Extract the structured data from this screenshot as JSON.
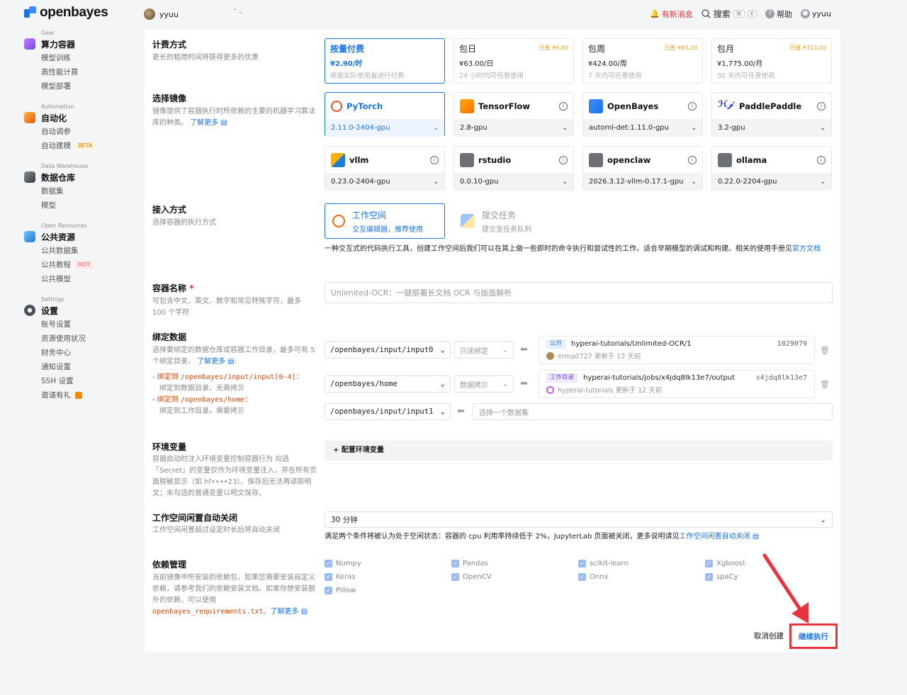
{
  "brand": {
    "name": "openbayes"
  },
  "header": {
    "user_name": "yyuu",
    "notice": "有新消息",
    "search": "搜索",
    "search_kbd_1": "⌘",
    "search_kbd_2": "K",
    "help": "帮助",
    "account_name": "yyuu"
  },
  "sidebar": {
    "groups": [
      {
        "sub": "Gear",
        "title": "算力容器",
        "items": [
          "模型训练",
          "高性能计算",
          "模型部署"
        ]
      },
      {
        "sub": "Automation",
        "title": "自动化",
        "items": [
          "自动调参",
          "自动建模"
        ],
        "tag": "BETA"
      },
      {
        "sub": "Data Warehouse",
        "title": "数据仓库",
        "items": [
          "数据集",
          "模型"
        ]
      },
      {
        "sub": "Open Resources",
        "title": "公共资源",
        "items": [
          "公共数据集",
          "公共教程",
          "公共模型"
        ],
        "tag": "HOT"
      },
      {
        "sub": "Settings",
        "title": "设置",
        "items": [
          "账号设置",
          "资源使用状况",
          "财务中心",
          "通知设置",
          "SSH 设置",
          "邀请有礼"
        ]
      }
    ]
  },
  "billing": {
    "title": "计费方式",
    "desc": "更长的租用时间将获得更多的优惠",
    "options": [
      {
        "name": "按量付费",
        "price": "¥2.90/时",
        "desc": "根据实际使用量进行付费",
        "save": ""
      },
      {
        "name": "包日",
        "price": "¥63.00/日",
        "desc": "24 小时内可任意使用",
        "save": "已省 ¥6.60"
      },
      {
        "name": "包周",
        "price": "¥424.00/周",
        "desc": "7 天内可任意使用",
        "save": "已省 ¥63.20"
      },
      {
        "name": "包月",
        "price": "¥1,775.00/月",
        "desc": "30 天内可任意使用",
        "save": "已省 ¥313.00"
      }
    ]
  },
  "image": {
    "title": "选择镜像",
    "desc": "镜像提供了容器执行时所依赖的主要的机器学习算法库的种类。",
    "learn_more": "了解更多",
    "cards": [
      {
        "name": "PyTorch",
        "version": "2.11.0-2404-gpu"
      },
      {
        "name": "TensorFlow",
        "version": "2.8-gpu"
      },
      {
        "name": "OpenBayes",
        "version": "automl-det:1.11.0-gpu"
      },
      {
        "name": "PaddlePaddle",
        "version": "3.2-gpu"
      },
      {
        "name": "vllm",
        "version": "0.23.0-2404-gpu"
      },
      {
        "name": "rstudio",
        "version": "0.0.10-gpu"
      },
      {
        "name": "openclaw",
        "version": "2026.3.12-vllm-0.17.1-gpu"
      },
      {
        "name": "ollama",
        "version": "0.22.0-2204-gpu"
      }
    ]
  },
  "access": {
    "title": "接入方式",
    "desc": "选择容器的执行方式",
    "opt1_title": "工作空间",
    "opt1_desc": "交互编辑器，推荐使用",
    "opt2_title": "提交任务",
    "opt2_desc": "提交至任务队列",
    "note": "一种交互式的代码执行工具，创建工作空间后我们可以在其上做一些即时的命令执行和尝试性的工作。适合早期模型的调试和构建。相关的使用手册见",
    "note_link": "官方文档"
  },
  "name": {
    "title": "容器名称",
    "required": "*",
    "desc": "可包含中文、英文、数字和常见特殊字符，最多 100 个字符",
    "placeholder": "Unlimited-OCR：一键部署长文档 OCR 与版面解析"
  },
  "bind": {
    "title": "绑定数据",
    "desc": "选择要绑定的数据仓库或容器工作目录，最多可有 5 个绑定目录，",
    "learn_more": "了解更多",
    "rule1_a": "绑定到 ",
    "rule1_code": "/openbayes/input/input[0-4]",
    "rule1_b": "：",
    "rule1_desc": "绑定到数据目录，无需拷贝",
    "rule2_a": "绑定到 ",
    "rule2_code": "/openbayes/home",
    "rule2_b": "：",
    "rule2_desc": "绑定到工作目录，需要拷贝",
    "rows": [
      {
        "path": "/openbayes/input/input0",
        "mode": "只读绑定",
        "badge": "公开",
        "source": "hyperai-tutorials/Unlimited-OCR/1",
        "hash": "1029079",
        "meta": "erma0727 更新于 12 天前"
      },
      {
        "path": "/openbayes/home",
        "mode": "数据拷贝",
        "badge": "工作目录",
        "source": "hyperai-tutorials/jobs/x4jdq8lk13e7/output",
        "hash": "x4jdq8lk13e7",
        "meta": "hyperai-tutorials 更新于 12 天前"
      },
      {
        "path": "/openbayes/input/input1",
        "placeholder": "选择一个数据集"
      }
    ]
  },
  "env": {
    "title": "环境变量",
    "desc": "容器启动时注入环境变量控制容器行为 勾选「Secret」的变量仅作为环境变量注入，并在所有页面脱敏显示（如 hf••••23）、保存后无法再读取明文；未勾选的普通变量以明文保存。",
    "button": "+ 配置环境变量"
  },
  "idle": {
    "title": "工作空间闲置自动关闭",
    "desc": "工作空间闲置超过设定时长后将自动关闭",
    "value": "30 分钟",
    "note": "满足两个条件将被认为处于空闲状态：容器的 cpu 利用率持续低于 2%，JupyterLab 页面被关闭，更多说明请见",
    "note_link": "工作空间闲置自动关闭"
  },
  "deps": {
    "title": "依赖管理",
    "desc": "当前镜像中所安装的依赖包，如果您需要安装自定义依赖，请参考我们的依赖安装文档。如果你想安装额外的依赖，可以使用",
    "code": "openbayes_requirements.txt",
    "tail": "。",
    "learn_more": "了解更多",
    "packages": [
      "Numpy",
      "Pandas",
      "scikit-learn",
      "Xgboost",
      "Keras",
      "OpenCV",
      "Onnx",
      "spaCy",
      "Pillow"
    ]
  },
  "actions": {
    "cancel": "取消创建",
    "submit": "继续执行"
  },
  "colors": {
    "accent": "#1a73e8",
    "highlight": "#e8333a"
  }
}
